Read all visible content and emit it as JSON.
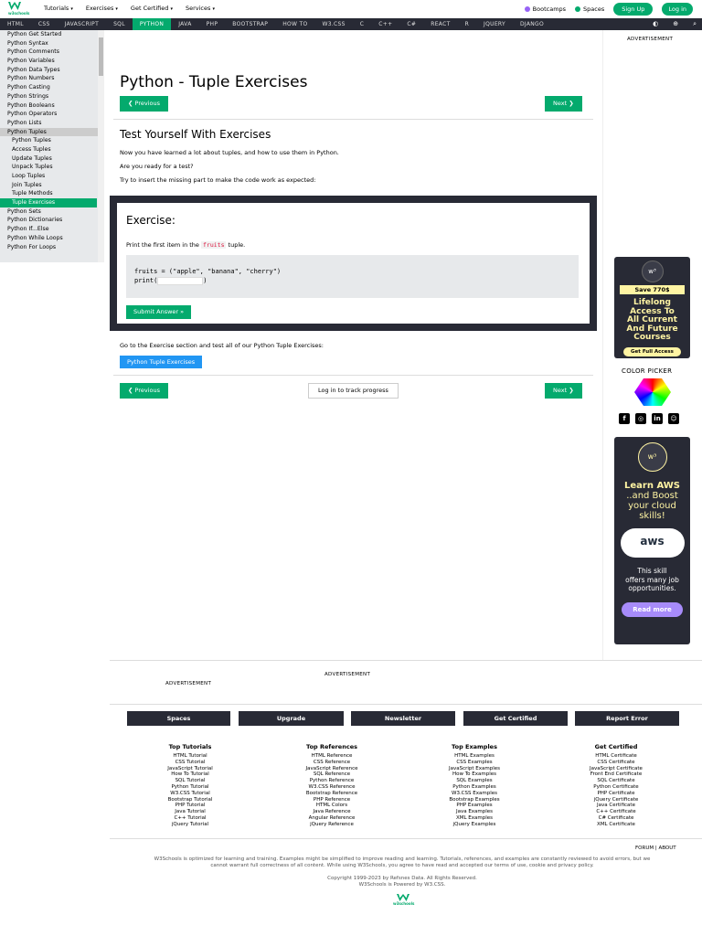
{
  "brand": {
    "logo_text": "w3schools"
  },
  "topmenu": {
    "tutorials": "Tutorials",
    "exercises": "Exercises",
    "certified": "Get Certified",
    "services": "Services"
  },
  "topright": {
    "bootcamps": "Bootcamps",
    "spaces": "Spaces",
    "signup": "Sign Up",
    "login": "Log in"
  },
  "subnav": [
    "HTML",
    "CSS",
    "JAVASCRIPT",
    "SQL",
    "PYTHON",
    "JAVA",
    "PHP",
    "BOOTSTRAP",
    "HOW TO",
    "W3.CSS",
    "C",
    "C++",
    "C#",
    "REACT",
    "R",
    "JQUERY",
    "DJANGO"
  ],
  "subnav_active": "PYTHON",
  "sidebar": [
    {
      "label": "Python Get Started",
      "level": 0
    },
    {
      "label": "Python Syntax",
      "level": 0
    },
    {
      "label": "Python Comments",
      "level": 0
    },
    {
      "label": "Python Variables",
      "level": 0
    },
    {
      "label": "Python Data Types",
      "level": 0
    },
    {
      "label": "Python Numbers",
      "level": 0
    },
    {
      "label": "Python Casting",
      "level": 0
    },
    {
      "label": "Python Strings",
      "level": 0
    },
    {
      "label": "Python Booleans",
      "level": 0
    },
    {
      "label": "Python Operators",
      "level": 0
    },
    {
      "label": "Python Lists",
      "level": 0
    },
    {
      "label": "Python Tuples",
      "level": 0,
      "open": true
    },
    {
      "label": "Python Tuples",
      "level": 1
    },
    {
      "label": "Access Tuples",
      "level": 1
    },
    {
      "label": "Update Tuples",
      "level": 1
    },
    {
      "label": "Unpack Tuples",
      "level": 1
    },
    {
      "label": "Loop Tuples",
      "level": 1
    },
    {
      "label": "Join Tuples",
      "level": 1
    },
    {
      "label": "Tuple Methods",
      "level": 1
    },
    {
      "label": "Tuple Exercises",
      "level": 1,
      "active": true
    },
    {
      "label": "Python Sets",
      "level": 0
    },
    {
      "label": "Python Dictionaries",
      "level": 0
    },
    {
      "label": "Python If...Else",
      "level": 0
    },
    {
      "label": "Python While Loops",
      "level": 0
    },
    {
      "label": "Python For Loops",
      "level": 0
    }
  ],
  "main": {
    "title": "Python - Tuple Exercises",
    "prev": "❮ Previous",
    "next": "Next ❯",
    "h2": "Test Yourself With Exercises",
    "p1": "Now you have learned a lot about tuples, and how to use them in Python.",
    "p2": "Are you ready for a test?",
    "p3": "Try to insert the missing part to make the code work as expected:",
    "exercise": {
      "title": "Exercise:",
      "desc_pre": "Print the first item in the ",
      "desc_kw": "fruits",
      "desc_post": " tuple.",
      "code_line1": "fruits = (\"apple\", \"banana\", \"cherry\")",
      "code_line2_pre": "print(",
      "code_line2_post": ")",
      "submit": "Submit Answer »"
    },
    "goto": "Go to the Exercise section and test all of our Python Tuple Exercises:",
    "exercises_btn": "Python Tuple Exercises",
    "track": "Log in to track progress"
  },
  "right": {
    "advertisement": "ADVERTISEMENT",
    "ad1": {
      "badge": "w³",
      "save": "Save 770$",
      "lines": [
        "Lifelong",
        "Access To",
        "All Current",
        "And Future",
        "Courses"
      ],
      "cta": "Get Full Access"
    },
    "color_picker": "COLOR PICKER",
    "ad2": {
      "badge": "w³",
      "l1": "Learn AWS",
      "l2": [
        "..and Boost",
        "your cloud",
        "skills!"
      ],
      "cloud": "aws",
      "skill": [
        "This skill",
        "offers many job",
        "opportunities."
      ],
      "cta": "Read more"
    }
  },
  "footer": {
    "advertisement": "ADVERTISEMENT",
    "buttons": [
      "Spaces",
      "Upgrade",
      "Newsletter",
      "Get Certified",
      "Report Error"
    ],
    "columns": [
      {
        "title": "Top Tutorials",
        "items": [
          "HTML Tutorial",
          "CSS Tutorial",
          "JavaScript Tutorial",
          "How To Tutorial",
          "SQL Tutorial",
          "Python Tutorial",
          "W3.CSS Tutorial",
          "Bootstrap Tutorial",
          "PHP Tutorial",
          "Java Tutorial",
          "C++ Tutorial",
          "jQuery Tutorial"
        ]
      },
      {
        "title": "Top References",
        "items": [
          "HTML Reference",
          "CSS Reference",
          "JavaScript Reference",
          "SQL Reference",
          "Python Reference",
          "W3.CSS Reference",
          "Bootstrap Reference",
          "PHP Reference",
          "HTML Colors",
          "Java Reference",
          "Angular Reference",
          "jQuery Reference"
        ]
      },
      {
        "title": "Top Examples",
        "items": [
          "HTML Examples",
          "CSS Examples",
          "JavaScript Examples",
          "How To Examples",
          "SQL Examples",
          "Python Examples",
          "W3.CSS Examples",
          "Bootstrap Examples",
          "PHP Examples",
          "Java Examples",
          "XML Examples",
          "jQuery Examples"
        ]
      },
      {
        "title": "Get Certified",
        "items": [
          "HTML Certificate",
          "CSS Certificate",
          "JavaScript Certificate",
          "Front End Certificate",
          "SQL Certificate",
          "Python Certificate",
          "PHP Certificate",
          "jQuery Certificate",
          "Java Certificate",
          "C++ Certificate",
          "C# Certificate",
          "XML Certificate"
        ]
      }
    ],
    "forum": "FORUM",
    "about": "ABOUT",
    "disclaimer1": "W3Schools is optimized for learning and training. Examples might be simplified to improve reading and learning. Tutorials, references, and examples are constantly reviewed to avoid errors, but we",
    "disclaimer2": "cannot warrant full correctness of all content. While using W3Schools, you agree to have read and accepted our terms of use, cookie and privacy policy.",
    "copyright": "Copyright 1999-2023 by Refsnes Data. All Rights Reserved.",
    "powered": "W3Schools is Powered by W3.CSS."
  },
  "colors": {
    "accent": "#04AA6D",
    "dark": "#282A35",
    "blue": "#2196F3",
    "yellow": "#FFF4A3"
  }
}
